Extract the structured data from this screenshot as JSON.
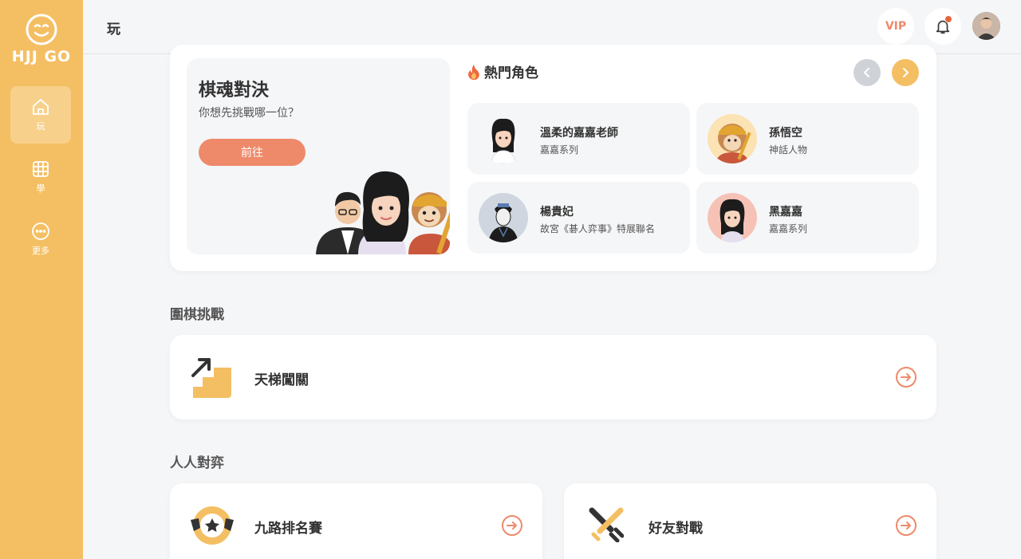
{
  "app": {
    "name": "HJJ GO"
  },
  "sidebar": {
    "items": [
      {
        "label": "玩",
        "icon": "home-icon",
        "active": true
      },
      {
        "label": "學",
        "icon": "board-icon",
        "active": false
      },
      {
        "label": "更多",
        "icon": "more-icon",
        "active": false
      }
    ]
  },
  "header": {
    "title": "玩",
    "vip_label": "VIP"
  },
  "battle": {
    "title": "棋魂對決",
    "subtitle": "你想先挑戰哪一位？",
    "button_label": "前往"
  },
  "hot": {
    "title": "熱門角色",
    "characters": [
      {
        "name": "溫柔的嘉嘉老師",
        "tag": "嘉嘉系列"
      },
      {
        "name": "孫悟空",
        "tag": "神話人物"
      },
      {
        "name": "楊貴妃",
        "tag": "故宮《碁人弈事》特展聯名"
      },
      {
        "name": "黑嘉嘉",
        "tag": "嘉嘉系列"
      }
    ]
  },
  "sections": {
    "challenge": {
      "title": "圍棋挑戰",
      "items": [
        {
          "label": "天梯闖關",
          "icon": "stairs-icon"
        }
      ]
    },
    "pvp": {
      "title": "人人對弈",
      "items": [
        {
          "label": "九路排名賽",
          "icon": "medal-icon"
        },
        {
          "label": "好友對戰",
          "icon": "crossed-swords-icon"
        }
      ]
    }
  },
  "colors": {
    "accent": "#f4bf63",
    "primary": "#ee8a6a",
    "background": "#f5f6f8"
  }
}
